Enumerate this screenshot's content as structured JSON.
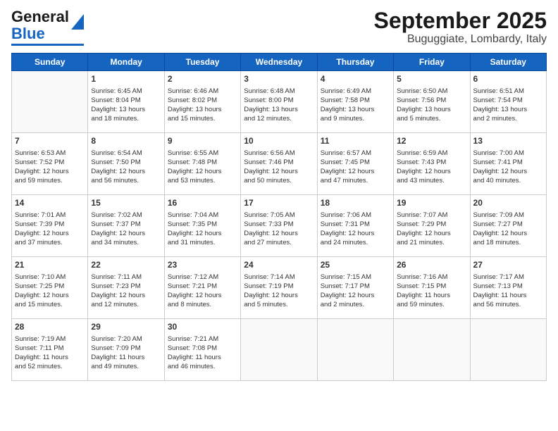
{
  "header": {
    "logo_general": "General",
    "logo_blue": "Blue",
    "title": "September 2025",
    "subtitle": "Buguggiate, Lombardy, Italy"
  },
  "days_of_week": [
    "Sunday",
    "Monday",
    "Tuesday",
    "Wednesday",
    "Thursday",
    "Friday",
    "Saturday"
  ],
  "weeks": [
    {
      "cells": [
        {
          "day": "",
          "content": ""
        },
        {
          "day": "1",
          "content": "Sunrise: 6:45 AM\nSunset: 8:04 PM\nDaylight: 13 hours\nand 18 minutes."
        },
        {
          "day": "2",
          "content": "Sunrise: 6:46 AM\nSunset: 8:02 PM\nDaylight: 13 hours\nand 15 minutes."
        },
        {
          "day": "3",
          "content": "Sunrise: 6:48 AM\nSunset: 8:00 PM\nDaylight: 13 hours\nand 12 minutes."
        },
        {
          "day": "4",
          "content": "Sunrise: 6:49 AM\nSunset: 7:58 PM\nDaylight: 13 hours\nand 9 minutes."
        },
        {
          "day": "5",
          "content": "Sunrise: 6:50 AM\nSunset: 7:56 PM\nDaylight: 13 hours\nand 5 minutes."
        },
        {
          "day": "6",
          "content": "Sunrise: 6:51 AM\nSunset: 7:54 PM\nDaylight: 13 hours\nand 2 minutes."
        }
      ]
    },
    {
      "cells": [
        {
          "day": "7",
          "content": "Sunrise: 6:53 AM\nSunset: 7:52 PM\nDaylight: 12 hours\nand 59 minutes."
        },
        {
          "day": "8",
          "content": "Sunrise: 6:54 AM\nSunset: 7:50 PM\nDaylight: 12 hours\nand 56 minutes."
        },
        {
          "day": "9",
          "content": "Sunrise: 6:55 AM\nSunset: 7:48 PM\nDaylight: 12 hours\nand 53 minutes."
        },
        {
          "day": "10",
          "content": "Sunrise: 6:56 AM\nSunset: 7:46 PM\nDaylight: 12 hours\nand 50 minutes."
        },
        {
          "day": "11",
          "content": "Sunrise: 6:57 AM\nSunset: 7:45 PM\nDaylight: 12 hours\nand 47 minutes."
        },
        {
          "day": "12",
          "content": "Sunrise: 6:59 AM\nSunset: 7:43 PM\nDaylight: 12 hours\nand 43 minutes."
        },
        {
          "day": "13",
          "content": "Sunrise: 7:00 AM\nSunset: 7:41 PM\nDaylight: 12 hours\nand 40 minutes."
        }
      ]
    },
    {
      "cells": [
        {
          "day": "14",
          "content": "Sunrise: 7:01 AM\nSunset: 7:39 PM\nDaylight: 12 hours\nand 37 minutes."
        },
        {
          "day": "15",
          "content": "Sunrise: 7:02 AM\nSunset: 7:37 PM\nDaylight: 12 hours\nand 34 minutes."
        },
        {
          "day": "16",
          "content": "Sunrise: 7:04 AM\nSunset: 7:35 PM\nDaylight: 12 hours\nand 31 minutes."
        },
        {
          "day": "17",
          "content": "Sunrise: 7:05 AM\nSunset: 7:33 PM\nDaylight: 12 hours\nand 27 minutes."
        },
        {
          "day": "18",
          "content": "Sunrise: 7:06 AM\nSunset: 7:31 PM\nDaylight: 12 hours\nand 24 minutes."
        },
        {
          "day": "19",
          "content": "Sunrise: 7:07 AM\nSunset: 7:29 PM\nDaylight: 12 hours\nand 21 minutes."
        },
        {
          "day": "20",
          "content": "Sunrise: 7:09 AM\nSunset: 7:27 PM\nDaylight: 12 hours\nand 18 minutes."
        }
      ]
    },
    {
      "cells": [
        {
          "day": "21",
          "content": "Sunrise: 7:10 AM\nSunset: 7:25 PM\nDaylight: 12 hours\nand 15 minutes."
        },
        {
          "day": "22",
          "content": "Sunrise: 7:11 AM\nSunset: 7:23 PM\nDaylight: 12 hours\nand 12 minutes."
        },
        {
          "day": "23",
          "content": "Sunrise: 7:12 AM\nSunset: 7:21 PM\nDaylight: 12 hours\nand 8 minutes."
        },
        {
          "day": "24",
          "content": "Sunrise: 7:14 AM\nSunset: 7:19 PM\nDaylight: 12 hours\nand 5 minutes."
        },
        {
          "day": "25",
          "content": "Sunrise: 7:15 AM\nSunset: 7:17 PM\nDaylight: 12 hours\nand 2 minutes."
        },
        {
          "day": "26",
          "content": "Sunrise: 7:16 AM\nSunset: 7:15 PM\nDaylight: 11 hours\nand 59 minutes."
        },
        {
          "day": "27",
          "content": "Sunrise: 7:17 AM\nSunset: 7:13 PM\nDaylight: 11 hours\nand 56 minutes."
        }
      ]
    },
    {
      "cells": [
        {
          "day": "28",
          "content": "Sunrise: 7:19 AM\nSunset: 7:11 PM\nDaylight: 11 hours\nand 52 minutes."
        },
        {
          "day": "29",
          "content": "Sunrise: 7:20 AM\nSunset: 7:09 PM\nDaylight: 11 hours\nand 49 minutes."
        },
        {
          "day": "30",
          "content": "Sunrise: 7:21 AM\nSunset: 7:08 PM\nDaylight: 11 hours\nand 46 minutes."
        },
        {
          "day": "",
          "content": ""
        },
        {
          "day": "",
          "content": ""
        },
        {
          "day": "",
          "content": ""
        },
        {
          "day": "",
          "content": ""
        }
      ]
    }
  ]
}
